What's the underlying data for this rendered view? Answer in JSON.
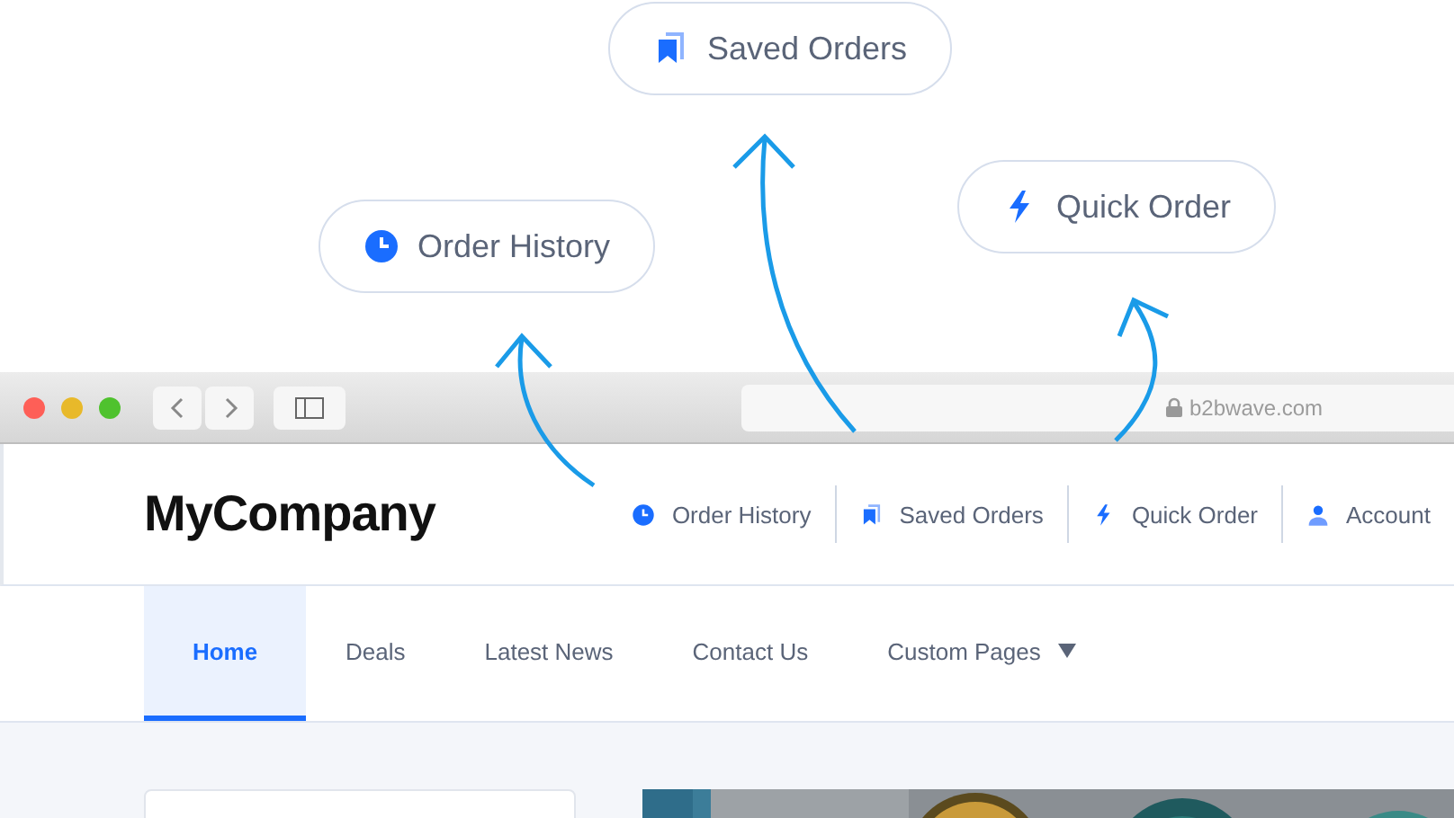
{
  "callouts": [
    {
      "label": "Saved Orders",
      "kind": "bookmark"
    },
    {
      "label": "Order History",
      "kind": "clock"
    },
    {
      "label": "Quick Order",
      "kind": "bolt"
    }
  ],
  "browser": {
    "url": "b2bwave.com"
  },
  "site": {
    "logo": "MyCompany",
    "header_links": [
      {
        "label": "Order History",
        "kind": "clock"
      },
      {
        "label": "Saved Orders",
        "kind": "bookmark"
      },
      {
        "label": "Quick Order",
        "kind": "bolt"
      },
      {
        "label": "Account",
        "kind": "person"
      }
    ],
    "nav": [
      {
        "label": "Home",
        "selected": true,
        "kind": "link"
      },
      {
        "label": "Deals",
        "selected": false,
        "kind": "link"
      },
      {
        "label": "Latest News",
        "selected": false,
        "kind": "link"
      },
      {
        "label": "Contact Us",
        "selected": false,
        "kind": "link"
      },
      {
        "label": "Custom Pages",
        "selected": false,
        "kind": "dropdown"
      }
    ]
  }
}
